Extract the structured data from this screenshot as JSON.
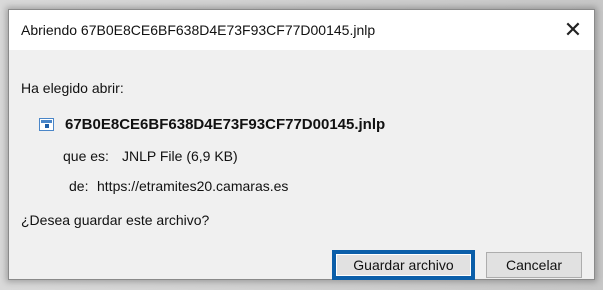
{
  "dialog": {
    "title": "Abriendo 67B0E8CE6BF638D4E73F93CF77D00145.jnlp",
    "close_glyph": "✕",
    "intro": "Ha elegido abrir:",
    "file_icon": "jnlp-file-icon",
    "filename": "67B0E8CE6BF638D4E73F93CF77D00145.jnlp",
    "type_label": "que es:",
    "type_value": "JNLP File (6,9 KB)",
    "from_label": "de:",
    "from_value": "https://etramites20.camaras.es",
    "question": "¿Desea guardar este archivo?",
    "save_button": "Guardar archivo",
    "cancel_button": "Cancelar"
  },
  "colors": {
    "accent": "#0a5ea9",
    "body_bg": "#f0f0f0"
  }
}
